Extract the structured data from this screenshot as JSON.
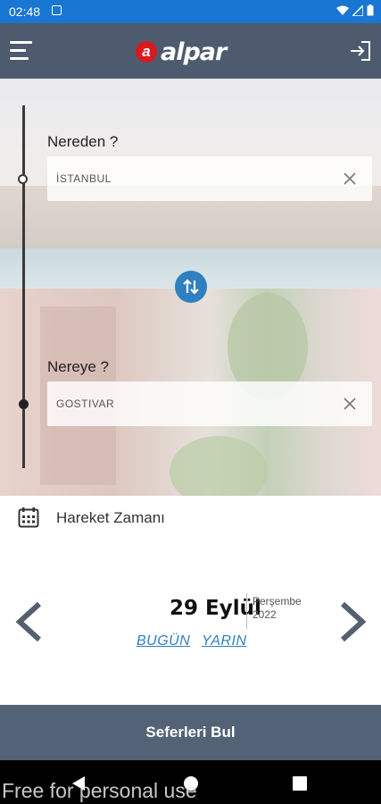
{
  "status_bar": {
    "time": "02:48"
  },
  "app_bar": {
    "logo_text": "alpar",
    "logo_badge": "a"
  },
  "route": {
    "from_label": "Nereden ?",
    "from_value": "İSTANBUL",
    "to_label": "Nereye ?",
    "to_value": "GOSTIVAR"
  },
  "date": {
    "section_title": "Hareket Zamanı",
    "day": "29 Eylül",
    "weekday": "Perşembe",
    "year": "2022",
    "today_label": "BUGÜN",
    "tomorrow_label": "YARIN"
  },
  "search_button": "Seferleri Bul",
  "watermark": "Free for personal use",
  "colors": {
    "status_bar": "#1976d2",
    "app_bar": "#4e5b6e",
    "accent": "#2f7fc1",
    "button": "#546277",
    "logo_red": "#d71920"
  },
  "icons": [
    "menu-icon",
    "login-icon",
    "clear-icon",
    "swap-icon",
    "calendar-icon",
    "chevron-left-icon",
    "chevron-right-icon",
    "back-icon",
    "home-icon",
    "recents-icon"
  ]
}
